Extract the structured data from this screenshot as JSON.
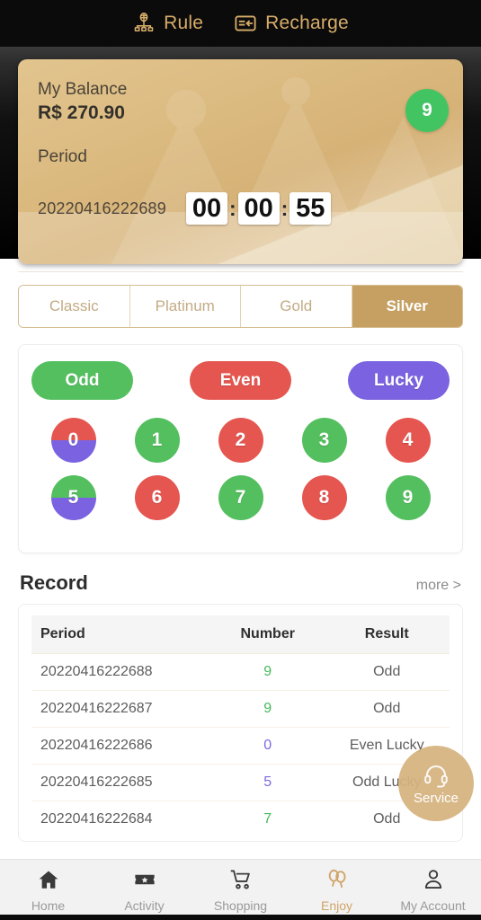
{
  "topbar": {
    "items": [
      {
        "label": "Rule",
        "icon": "network-rule-icon"
      },
      {
        "label": "Recharge",
        "icon": "card-recharge-icon"
      }
    ],
    "text_color": "#d8ad6a",
    "bg_color": "#0b0b0b"
  },
  "balance_card": {
    "balance_label": "My Balance",
    "balance_amount": "R$ 270.90",
    "period_label": "Period",
    "period_id": "20220416222689",
    "badge_number": "9",
    "badge_color": "#43c463",
    "timer": {
      "hours": "00",
      "minutes": "00",
      "seconds": "55",
      "separator": ":"
    }
  },
  "tabs": [
    {
      "label": "Classic",
      "active": false
    },
    {
      "label": "Platinum",
      "active": false
    },
    {
      "label": "Gold",
      "active": false
    },
    {
      "label": "Silver",
      "active": true
    }
  ],
  "tab_active_color": "#c5a062",
  "bet_buttons": [
    {
      "label": "Odd",
      "color": "#54bf5f"
    },
    {
      "label": "Even",
      "color": "#e4564f"
    },
    {
      "label": "Lucky",
      "color": "#7a62e0"
    }
  ],
  "number_balls": [
    {
      "label": "0",
      "top_color": "#e4564f",
      "bottom_color": "#7a62e0",
      "split": true
    },
    {
      "label": "1",
      "top_color": "#54bf5f",
      "bottom_color": "#54bf5f",
      "split": false
    },
    {
      "label": "2",
      "top_color": "#e4564f",
      "bottom_color": "#e4564f",
      "split": false
    },
    {
      "label": "3",
      "top_color": "#54bf5f",
      "bottom_color": "#54bf5f",
      "split": false
    },
    {
      "label": "4",
      "top_color": "#e4564f",
      "bottom_color": "#e4564f",
      "split": false
    },
    {
      "label": "5",
      "top_color": "#54bf5f",
      "bottom_color": "#7a62e0",
      "split": true
    },
    {
      "label": "6",
      "top_color": "#e4564f",
      "bottom_color": "#e4564f",
      "split": false
    },
    {
      "label": "7",
      "top_color": "#54bf5f",
      "bottom_color": "#54bf5f",
      "split": false
    },
    {
      "label": "8",
      "top_color": "#e4564f",
      "bottom_color": "#e4564f",
      "split": false
    },
    {
      "label": "9",
      "top_color": "#54bf5f",
      "bottom_color": "#54bf5f",
      "split": false
    }
  ],
  "record": {
    "title": "Record",
    "more_label": "more >",
    "columns": [
      "Period",
      "Number",
      "Result"
    ],
    "rows": [
      {
        "period": "20220416222688",
        "number": "9",
        "number_color": "green",
        "result": "Odd"
      },
      {
        "period": "20220416222687",
        "number": "9",
        "number_color": "green",
        "result": "Odd"
      },
      {
        "period": "20220416222686",
        "number": "0",
        "number_color": "purple",
        "result": "Even Lucky"
      },
      {
        "period": "20220416222685",
        "number": "5",
        "number_color": "purple",
        "result": "Odd Lucky"
      },
      {
        "period": "20220416222684",
        "number": "7",
        "number_color": "green",
        "result": "Odd"
      }
    ]
  },
  "service_fab": {
    "label": "Service",
    "icon": "headset-icon",
    "color": "#d7b380"
  },
  "bottom_nav": {
    "items": [
      {
        "label": "Home",
        "icon": "home-icon",
        "active": false
      },
      {
        "label": "Activity",
        "icon": "ticket-star-icon",
        "active": false
      },
      {
        "label": "Shopping",
        "icon": "cart-icon",
        "active": false
      },
      {
        "label": "Enjoy",
        "icon": "balloons-icon",
        "active": true
      },
      {
        "label": "My Account",
        "icon": "person-icon",
        "active": false
      }
    ],
    "active_color": "#d0a469"
  }
}
